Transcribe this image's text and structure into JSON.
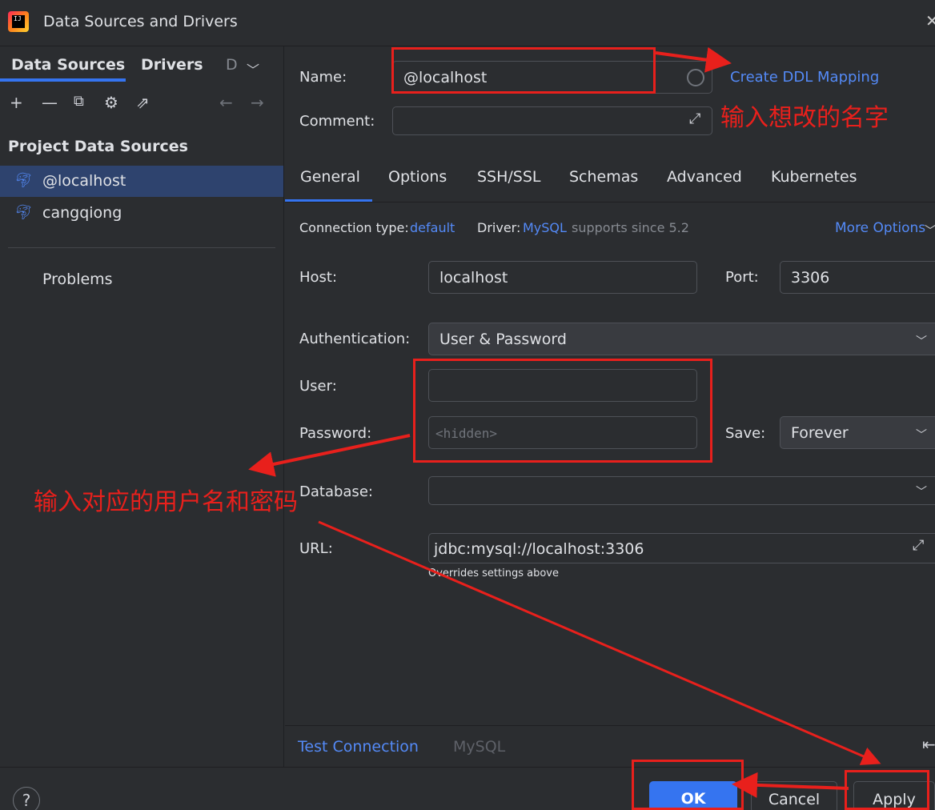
{
  "window": {
    "title": "Data Sources and Drivers",
    "app_icon_text": "IJ"
  },
  "left": {
    "tabs": [
      "Data Sources",
      "Drivers",
      "D"
    ],
    "section_title": "Project Data Sources",
    "sources": [
      "@localhost",
      "cangqiong"
    ],
    "problems": "Problems"
  },
  "form": {
    "name_label": "Name:",
    "name_value": "@localhost",
    "create_ddl": "Create DDL Mapping",
    "comment_label": "Comment:",
    "tabs": [
      "General",
      "Options",
      "SSH/SSL",
      "Schemas",
      "Advanced",
      "Kubernetes"
    ],
    "conn_type_label": "Connection type:",
    "conn_type_value": "default",
    "driver_label": "Driver:",
    "driver_value": "MySQL",
    "driver_note": "supports since 5.2",
    "more_options": "More Options",
    "host_label": "Host:",
    "host_value": "localhost",
    "port_label": "Port:",
    "port_value": "3306",
    "auth_label": "Authentication:",
    "auth_value": "User & Password",
    "user_label": "User:",
    "user_value": "",
    "password_label": "Password:",
    "password_placeholder": "<hidden>",
    "save_label": "Save:",
    "save_value": "Forever",
    "database_label": "Database:",
    "database_value": "",
    "url_label": "URL:",
    "url_value": "jdbc:mysql://localhost:3306",
    "url_note": "Overrides settings above"
  },
  "bottom": {
    "test_connection": "Test Connection",
    "driver_name": "MySQL"
  },
  "footer": {
    "help": "?",
    "ok": "OK",
    "cancel": "Cancel",
    "apply": "Apply"
  },
  "annotations": {
    "rename": "输入想改的名字",
    "credentials": "输入对应的用户名和密码"
  },
  "colors": {
    "accent": "#3574f0",
    "link": "#548af7",
    "annotation": "#e8201c",
    "selection": "#2e436e"
  }
}
